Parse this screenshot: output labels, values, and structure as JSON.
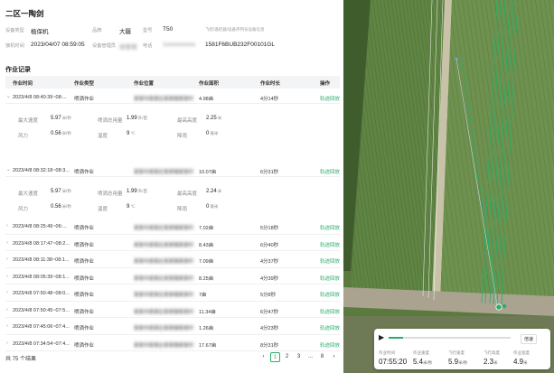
{
  "page": {
    "title": "二区一陶剑"
  },
  "info": {
    "row1": [
      {
        "label": "设备类型",
        "value": "植保机"
      },
      {
        "label": "品牌",
        "value": "大疆"
      },
      {
        "label": "型号",
        "value": "T50"
      },
      {
        "label": "",
        "value": "飞控/遥控器/设备序列号设备信息"
      }
    ],
    "row2": [
      {
        "label": "接机时间",
        "value": "2023/04/07 08:59:05"
      },
      {
        "label": "设备管理员",
        "value": "张管理"
      },
      {
        "label": "电话",
        "value": "1xxxxxxxxxx"
      },
      {
        "label": "",
        "value": "1581F6BUB232F00101GL"
      }
    ]
  },
  "records": {
    "title": "作业记录",
    "columns": [
      "作业时间",
      "作业类型",
      "作业位置",
      "作业面积",
      "作业时长",
      "操作"
    ],
    "expanded": [
      {
        "time": "2023/4/8 08:40:39~08:...",
        "type": "喷洒作业",
        "location": "某某市某某区某某镇某某村",
        "area": "4.98亩",
        "duration": "4分14秒",
        "action": "轨迹回放",
        "details": [
          {
            "label": "最大速度",
            "value": "5.97",
            "unit": "米/秒"
          },
          {
            "label": "喷洒总用量",
            "value": "1.99",
            "unit": "升/亩"
          },
          {
            "label": "最高高度",
            "value": "2.25",
            "unit": "米"
          },
          {
            "label": "风力",
            "value": "0.56",
            "unit": "米/秒"
          },
          {
            "label": "温度",
            "value": "9",
            "unit": "℃"
          },
          {
            "label": "降雨",
            "value": "0",
            "unit": "毫米"
          }
        ]
      },
      {
        "time": "2023/4/8 08:32:18~08:3...",
        "type": "喷洒作业",
        "location": "某某市某某区某某镇某某村",
        "area": "10.07亩",
        "duration": "6分31秒",
        "action": "轨迹回放",
        "details": [
          {
            "label": "最大速度",
            "value": "5.97",
            "unit": "米/秒"
          },
          {
            "label": "喷洒总用量",
            "value": "1.99",
            "unit": "升/亩"
          },
          {
            "label": "最高高度",
            "value": "2.24",
            "unit": "米"
          },
          {
            "label": "风力",
            "value": "0.56",
            "unit": "米/秒"
          },
          {
            "label": "温度",
            "value": "9",
            "unit": "℃"
          },
          {
            "label": "降雨",
            "value": "0",
            "unit": "毫米"
          }
        ]
      }
    ],
    "rows": [
      {
        "time": "2023/4/8 08:25:49~06:...",
        "type": "喷洒作业",
        "location": "某某市某某区某某镇某某村",
        "area": "7.02亩",
        "duration": "5分18秒",
        "action": "轨迹回放"
      },
      {
        "time": "2023/4/8 08:17:47~08:2...",
        "type": "喷洒作业",
        "location": "某某市某某区某某镇某某村",
        "area": "8.43亩",
        "duration": "6分40秒",
        "action": "轨迹回放"
      },
      {
        "time": "2023/4/8 08:11:38~08:1...",
        "type": "喷洒作业",
        "location": "某某市某某区某某镇某某村",
        "area": "7.09亩",
        "duration": "4分37秒",
        "action": "轨迹回放"
      },
      {
        "time": "2023/4/8 08:05:39~08:1...",
        "type": "喷洒作业",
        "location": "某某市某某区某某镇某某村",
        "area": "8.25亩",
        "duration": "4分39秒",
        "action": "轨迹回放"
      },
      {
        "time": "2023/4/8 07:50:48~08:0...",
        "type": "喷洒作业",
        "location": "某某市某某区某某镇某某村",
        "area": "7亩",
        "duration": "5分8秒",
        "action": "轨迹回放"
      },
      {
        "time": "2023/4/8 07:50:45~07:5...",
        "type": "喷洒作业",
        "location": "某某市某某区某某镇某某村",
        "area": "11.34亩",
        "duration": "6分47秒",
        "action": "轨迹回放"
      },
      {
        "time": "2023/4/8 07:45:06~07:4...",
        "type": "喷洒作业",
        "location": "某某市某某区某某镇某某村",
        "area": "1.26亩",
        "duration": "4分23秒",
        "action": "轨迹回放"
      },
      {
        "time": "2023/4/8 07:34:54~07:4...",
        "type": "喷洒作业",
        "location": "某某市某某区某某镇某某村",
        "area": "17.67亩",
        "duration": "8分31秒",
        "action": "轨迹回放"
      }
    ]
  },
  "pagination": {
    "total": "共 75 个结果",
    "prev": "‹",
    "pages": [
      "1",
      "2",
      "3",
      "...",
      "8"
    ],
    "next": "›",
    "current": "1"
  },
  "playback": {
    "speed_label": "倍速",
    "stats": [
      {
        "label": "作业时间",
        "value": "07:55:20",
        "unit": ""
      },
      {
        "label": "作业速度",
        "value": "5.4",
        "unit": "米/秒"
      },
      {
        "label": "飞行速度",
        "value": "5.9",
        "unit": "米/秒"
      },
      {
        "label": "飞行高度",
        "value": "2.3",
        "unit": "米"
      },
      {
        "label": "作业宽度",
        "value": "4.9",
        "unit": "米"
      }
    ],
    "progress": 0.12
  },
  "colors": {
    "accent": "#2aae67",
    "header_bg": "#f3f4f6"
  },
  "icons": {
    "expand": "chevron-down-icon",
    "collapse": "chevron-right-icon",
    "play": "play-icon"
  }
}
